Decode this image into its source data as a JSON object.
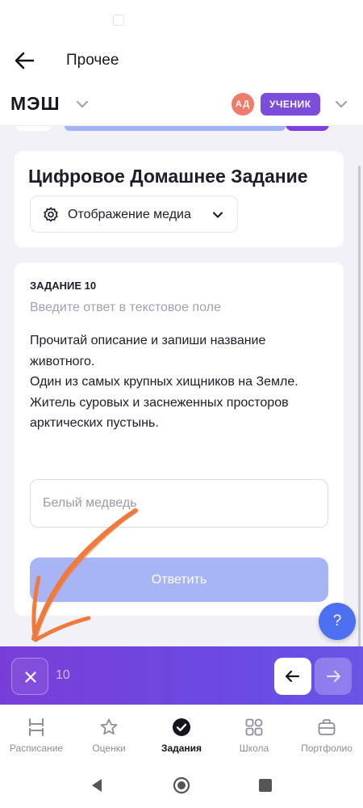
{
  "header": {
    "title": "Прочее"
  },
  "brand": {
    "logo_text": "МЭШ",
    "avatar_initials": "АД",
    "role_label": "УЧЕНИК"
  },
  "assignment": {
    "title": "Цифровое Домашнее Задание",
    "media_button_label": "Отображение медиа"
  },
  "task": {
    "label": "ЗАДАНИЕ 10",
    "hint": "Введите ответ в текстовое поле",
    "description_lines": [
      "Прочитай описание и запиши название",
      "животного.",
      "Один из самых крупных хищников на Земле.",
      "Житель суровых и заснеженных просторов",
      "арктических пустынь."
    ],
    "answer_value": "Белый медведь",
    "submit_label": "Ответить"
  },
  "help": {
    "label": "?"
  },
  "task_bar": {
    "number": "10"
  },
  "tabs": [
    {
      "label": "Расписание",
      "icon": "schedule-icon",
      "active": false
    },
    {
      "label": "Оценки",
      "icon": "star-icon",
      "active": false
    },
    {
      "label": "Задания",
      "icon": "check-circle-icon",
      "active": true
    },
    {
      "label": "Школа",
      "icon": "grid-icon",
      "active": false
    },
    {
      "label": "Портфолио",
      "icon": "briefcase-icon",
      "active": false
    }
  ],
  "colors": {
    "accent_purple": "#7c4ddb",
    "submit_disabled": "#a7b5f5",
    "help_blue": "#4c70f0",
    "avatar": "#ef7b6b",
    "annotation": "#f07a3c"
  }
}
